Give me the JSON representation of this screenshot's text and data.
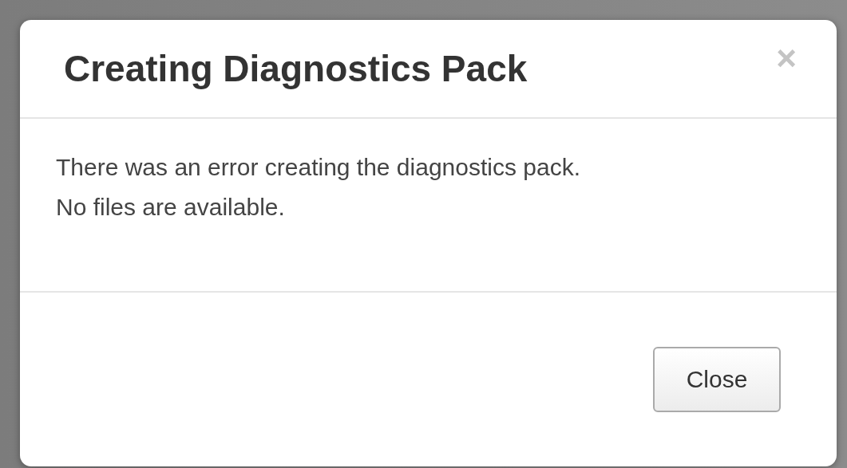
{
  "dialog": {
    "title": "Creating Diagnostics Pack",
    "close_glyph": "×",
    "message": [
      "There was an error creating the diagnostics pack.",
      "No files are available."
    ],
    "buttons": [
      "Close"
    ]
  }
}
